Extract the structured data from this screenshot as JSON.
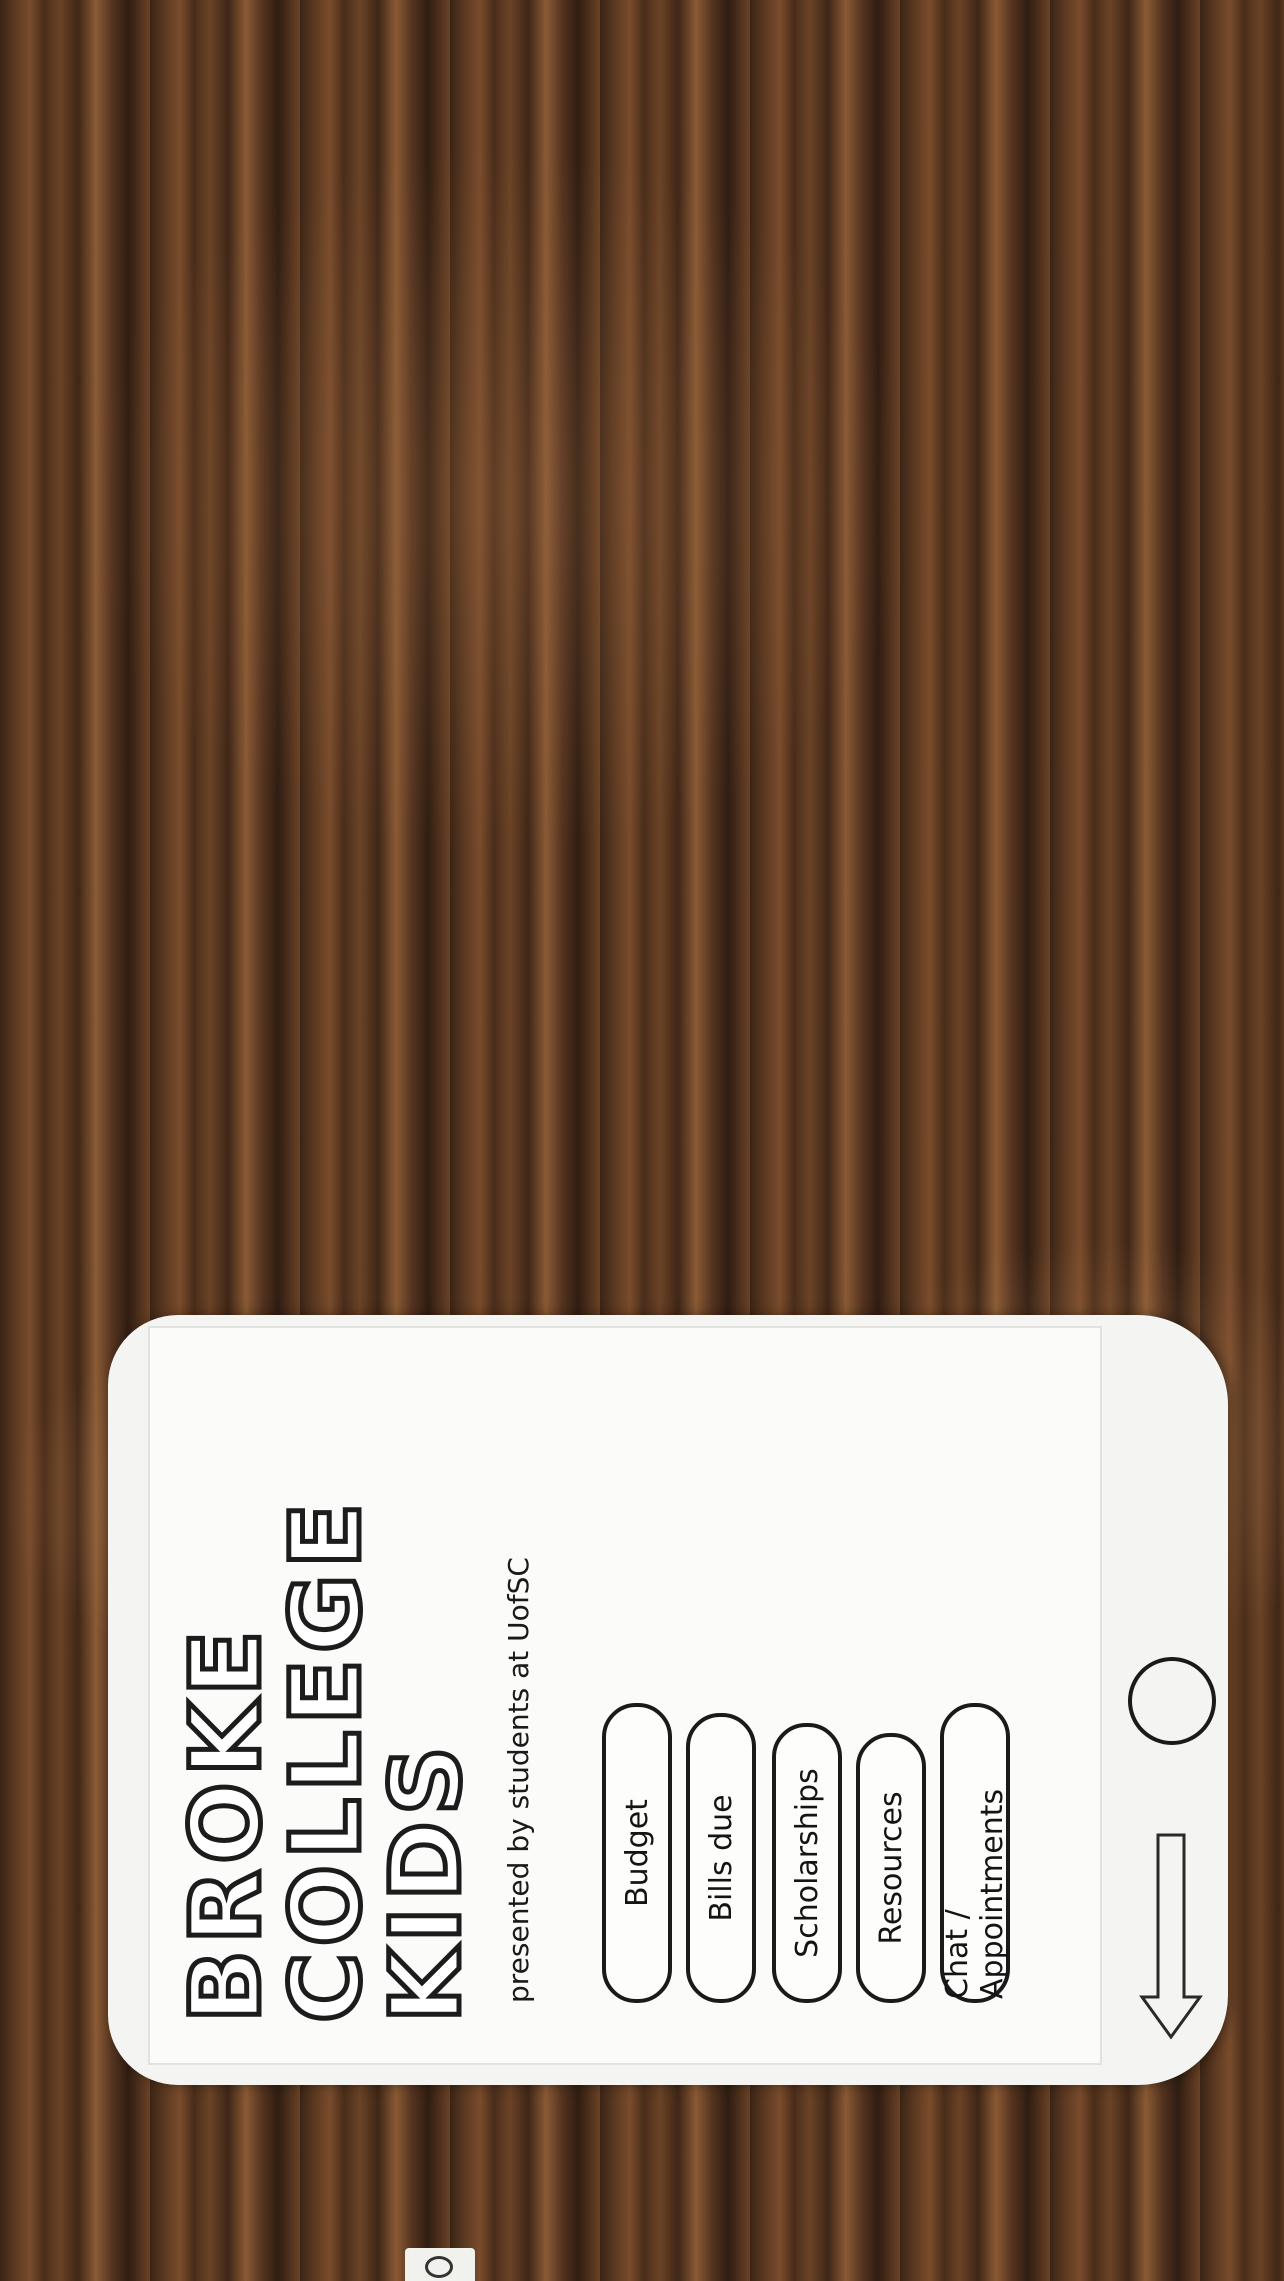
{
  "app": {
    "title_lines": [
      "BROKE",
      "COLLEGE",
      "KIDS"
    ],
    "subtitle": "presented by students at UofSC"
  },
  "menu": {
    "items": [
      {
        "label": "Budget"
      },
      {
        "label": "Bills due"
      },
      {
        "label": "Scholarships"
      },
      {
        "label": "Resources"
      },
      {
        "label": "Chat / Appointments"
      }
    ]
  },
  "icons": {
    "home": "home-button-icon",
    "back": "back-arrow-icon"
  }
}
